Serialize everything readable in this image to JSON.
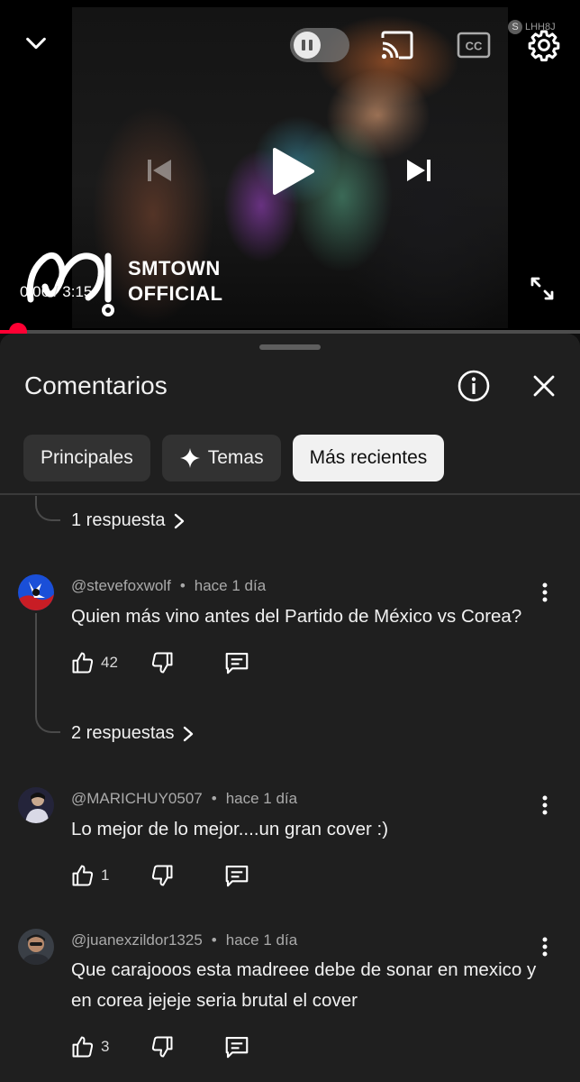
{
  "player": {
    "current_time": "0:06",
    "separator": " / ",
    "duration": "3:15",
    "progress_fraction": 0.031,
    "watermark_line1": "SMTOWN",
    "watermark_line2": "OFFICIAL",
    "corner_mark": "LHH8J",
    "icons": [
      "chevron-down-icon",
      "pause-icon",
      "cast-icon",
      "captions-icon",
      "settings-gear-icon",
      "previous-icon",
      "play-icon",
      "next-icon",
      "fullscreen-icon"
    ],
    "accent_color": "#ff0033"
  },
  "comments_panel": {
    "title": "Comentarios",
    "chips": [
      {
        "label": "Principales",
        "active": false
      },
      {
        "label": "Temas",
        "active": false
      },
      {
        "label": "Más recientes",
        "active": true
      }
    ],
    "top_replies_label": "1 respuesta",
    "comments": [
      {
        "author": "@stevefoxwolf",
        "time": "hace 1 día",
        "text": "Quien más vino antes del Partido de México vs Corea?",
        "likes": "42",
        "replies_label": "2 respuestas"
      },
      {
        "author": "@MARICHUY0507",
        "time": "hace 1 día",
        "text": "Lo mejor de lo mejor....un gran cover :)",
        "likes": "1"
      },
      {
        "author": "@juanexzildor1325",
        "time": "hace 1 día",
        "text": "Que carajooos esta madreee debe de sonar en mexico y en corea jejeje seria brutal el cover",
        "likes": "3"
      }
    ]
  }
}
